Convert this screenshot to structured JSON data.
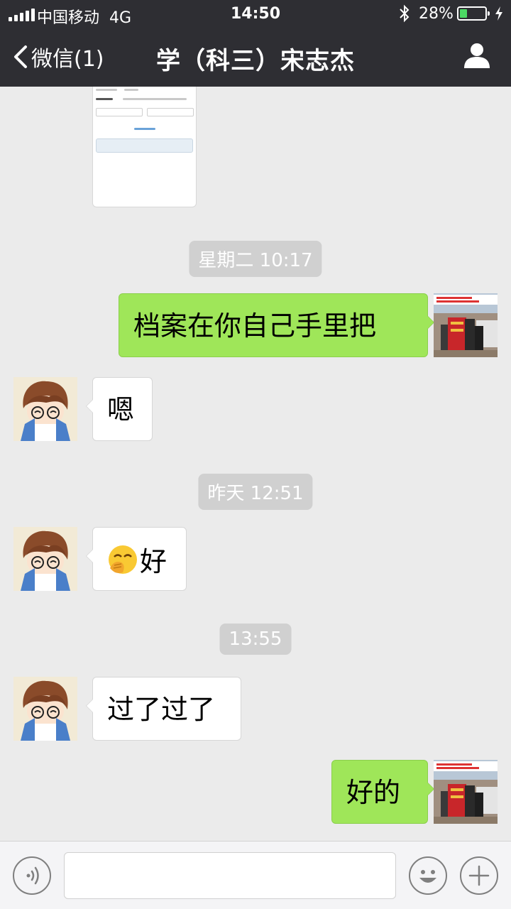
{
  "status_bar": {
    "carrier": "中国移动",
    "network": "4G",
    "time": "14:50",
    "battery_percent": "28%",
    "battery_level": 0.28
  },
  "nav": {
    "back_label": "微信(1)",
    "title": "学（科三）宋志杰"
  },
  "chat": {
    "timestamps": [
      "星期二 10:17",
      "昨天 12:51",
      "13:55"
    ],
    "messages": [
      {
        "direction": "out",
        "text": "档案在你自己手里把"
      },
      {
        "direction": "in",
        "text": "嗯"
      },
      {
        "direction": "in",
        "emoji": "face-with-hand-over-mouth-emoji",
        "text": "好"
      },
      {
        "direction": "in",
        "text": "过了过了"
      },
      {
        "direction": "out",
        "text": "好的"
      }
    ]
  },
  "colors": {
    "nav_bg": "#2e2e33",
    "chat_bg": "#ebebeb",
    "outgoing_bubble": "#9fe659",
    "incoming_bubble": "#ffffff",
    "timestamp_bg": "#d0d0d0"
  },
  "icons": {
    "back": "chevron-left-icon",
    "profile": "user-icon",
    "voice": "voice-icon",
    "emoji": "smiley-icon",
    "more": "plus-icon"
  }
}
